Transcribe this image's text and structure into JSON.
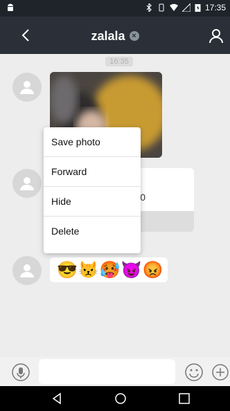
{
  "status_bar": {
    "time": "17:35"
  },
  "header": {
    "title": "zalala",
    "badge_symbol": "×"
  },
  "chat": {
    "timestamp": "16:35",
    "card_partial_text": "0",
    "emoji_message": [
      "😎",
      "😾",
      "🥵",
      "😈",
      "😡"
    ]
  },
  "context_menu": {
    "items": [
      "Save photo",
      "Forward",
      "Hide",
      "Delete"
    ]
  },
  "colors": {
    "header_bg": "#2b3038",
    "chat_bg": "#ededed",
    "menu_bg": "#ffffff"
  },
  "icons": {
    "back": "chevron-left-icon",
    "profile": "person-icon",
    "voice": "microphone-icon",
    "emoji": "smile-icon",
    "plus": "plus-icon"
  }
}
